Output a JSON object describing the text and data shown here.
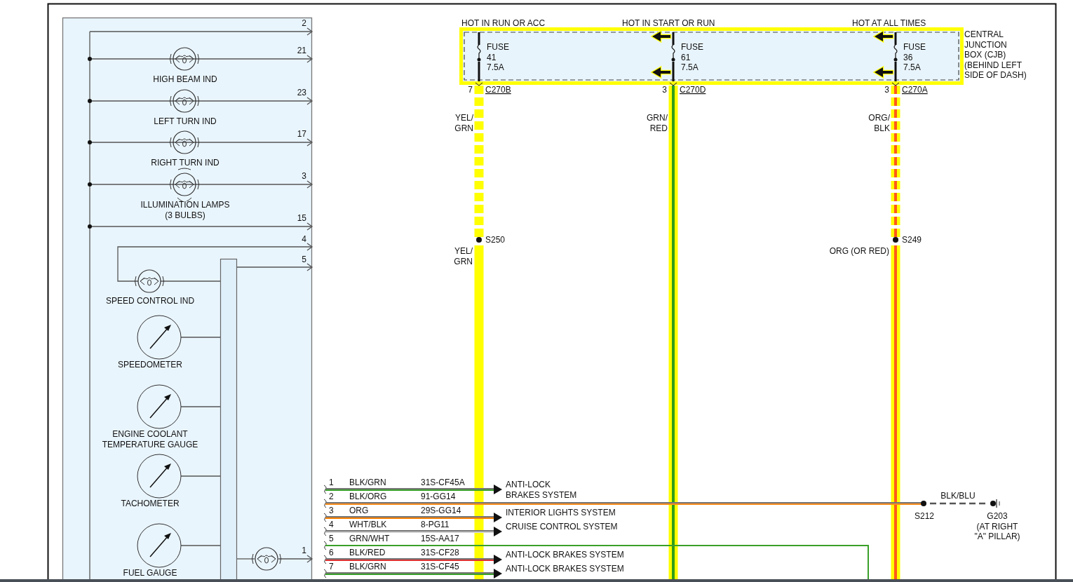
{
  "cluster": {
    "wires": [
      {
        "kind": "wire",
        "pin": "2"
      },
      {
        "kind": "bulb",
        "pin": "21",
        "label_lines": [
          "HIGH BEAM IND"
        ]
      },
      {
        "kind": "bulb",
        "pin": "23",
        "label_lines": [
          "LEFT TURN IND"
        ]
      },
      {
        "kind": "bulb",
        "pin": "17",
        "label_lines": [
          "RIGHT TURN IND"
        ]
      },
      {
        "kind": "lamps",
        "pin": "3",
        "label_lines": [
          "ILLUMINATION LAMPS",
          "(3 BULBS)"
        ]
      },
      {
        "kind": "wire",
        "pin": "15"
      }
    ],
    "speed_control": {
      "pin_in": "4",
      "pin_out": "5",
      "label": "SPEED CONTROL IND"
    },
    "gauges": [
      {
        "label_lines": [
          "SPEEDOMETER"
        ]
      },
      {
        "label_lines": [
          "ENGINE COOLANT",
          "TEMPERATURE GAUGE"
        ]
      },
      {
        "label_lines": [
          "TACHOMETER"
        ]
      },
      {
        "label_lines": [
          "FUEL GAUGE"
        ]
      }
    ],
    "traction_pin": "1"
  },
  "fuse_box": {
    "label_lines": [
      "CENTRAL",
      "JUNCTION",
      "BOX (CJB)",
      "(BEHIND LEFT",
      "SIDE OF DASH)"
    ],
    "fuses": [
      {
        "supply": "HOT IN RUN OR ACC",
        "name": "FUSE",
        "number": "41",
        "rating": "7.5A",
        "pin": "7",
        "connector": "C270B",
        "wire_lines": [
          "YEL/",
          "GRN"
        ],
        "color": "#ffff00",
        "feeds_left": false,
        "splice": {
          "name": "S250",
          "wire_lines": [
            "YEL/",
            "GRN"
          ]
        }
      },
      {
        "supply": "HOT IN START OR RUN",
        "name": "FUSE",
        "number": "61",
        "rating": "7.5A",
        "pin": "3",
        "connector": "C270D",
        "wire_lines": [
          "GRN/",
          "RED"
        ],
        "color": "#2e9e1a",
        "feeds_left": true
      },
      {
        "supply": "HOT AT ALL TIMES",
        "name": "FUSE",
        "number": "36",
        "rating": "7.5A",
        "pin": "3",
        "connector": "C270A",
        "wire_lines": [
          "ORG/",
          "BLK"
        ],
        "color": "#ff5a1a",
        "feeds_left": true,
        "splice": {
          "name": "S249",
          "wire_lines": [
            "ORG (OR RED)"
          ]
        }
      }
    ]
  },
  "connector_rows": [
    {
      "kind": "arrow",
      "pin": "1",
      "wire": "BLK/GRN",
      "circuit": "31S-CF45A",
      "color": "#3aa02a",
      "destination_lines": [
        "ANTI-LOCK",
        "BRAKES SYSTEM"
      ]
    },
    {
      "kind": "ground",
      "pin": "2",
      "wire": "BLK/ORG",
      "circuit": "91-GG14",
      "color": "#ff8c1a"
    },
    {
      "kind": "arrow",
      "pin": "3",
      "wire": "ORG",
      "circuit": "29S-GG14",
      "color": "#ff8000",
      "destination_lines": [
        "INTERIOR LIGHTS SYSTEM"
      ]
    },
    {
      "kind": "arrow",
      "pin": "4",
      "wire": "WHT/BLK",
      "circuit": "8-PG11",
      "color": "#d0d0d0",
      "destination_lines": [
        "CRUISE CONTROL SYSTEM"
      ]
    },
    {
      "kind": "loop",
      "pin": "5",
      "wire": "GRN/WHT",
      "circuit": "15S-AA17",
      "color": "#3aa02a"
    },
    {
      "kind": "arrow",
      "pin": "6",
      "wire": "BLK/RED",
      "circuit": "31S-CF28",
      "color": "#e03030",
      "destination_lines": [
        "ANTI-LOCK BRAKES SYSTEM"
      ]
    },
    {
      "kind": "arrow",
      "pin": "7",
      "wire": "BLK/GRN",
      "circuit": "31S-CF45",
      "color": "#3aa02a",
      "destination_lines": [
        "ANTI-LOCK BRAKES SYSTEM"
      ]
    }
  ],
  "ground": {
    "splice": "S212",
    "wire": "BLK/BLU",
    "name": "G203",
    "location_lines": [
      "(AT RIGHT",
      "\"A\" PILLAR)"
    ]
  }
}
